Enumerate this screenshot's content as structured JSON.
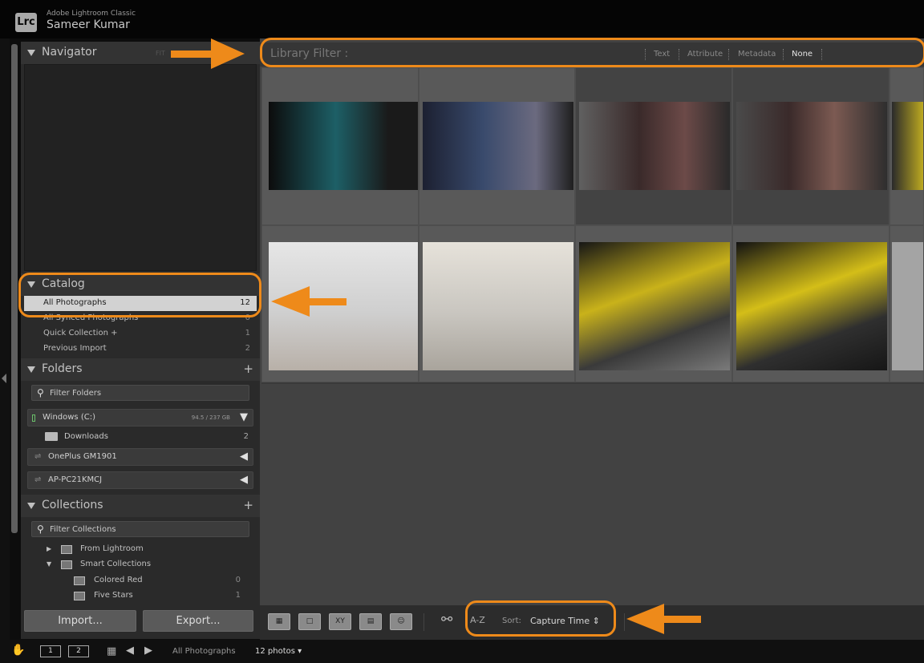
{
  "titlebar": {
    "app_name": "Adobe Lightroom Classic",
    "user_name": "Sameer Kumar",
    "logo": "Lrc"
  },
  "navigator": {
    "title": "Navigator",
    "fit_label": "FIT"
  },
  "catalog": {
    "title": "Catalog",
    "items": [
      {
        "label": "All Photographs",
        "count": "12"
      },
      {
        "label": "All Synced Photographs",
        "count": "0"
      },
      {
        "label": "Quick Collection +",
        "count": "1"
      },
      {
        "label": "Previous Import",
        "count": "2"
      }
    ]
  },
  "folders": {
    "title": "Folders",
    "filter_label": "Filter Folders",
    "volumes": [
      {
        "label": "Windows (C:)",
        "size": "94.5 / 237 GB"
      },
      {
        "label": "OnePlus GM1901"
      },
      {
        "label": "AP-PC21KMCJ"
      }
    ],
    "downloads": {
      "label": "Downloads",
      "count": "2"
    }
  },
  "collections": {
    "title": "Collections",
    "filter_label": "Filter Collections",
    "items": [
      {
        "label": "From Lightroom",
        "count": ""
      },
      {
        "label": "Smart Collections",
        "count": ""
      },
      {
        "label": "Colored Red",
        "count": "0"
      },
      {
        "label": "Five Stars",
        "count": "1"
      }
    ]
  },
  "buttons": {
    "import": "Import...",
    "export": "Export..."
  },
  "library_filter": {
    "title": "Library Filter :",
    "options": [
      "Text",
      "Attribute",
      "Metadata",
      "None"
    ],
    "active": "None"
  },
  "toolbar": {
    "sort_label": "Sort:",
    "sort_value": "Capture Time",
    "sort_icon": "A-Z"
  },
  "statusbar": {
    "monitor1": "1",
    "monitor2": "2",
    "source": "All Photographs",
    "count": "12 photos"
  },
  "colors": {
    "annotation": "#ee8a1a",
    "selected_row": "#d2d2d2"
  }
}
